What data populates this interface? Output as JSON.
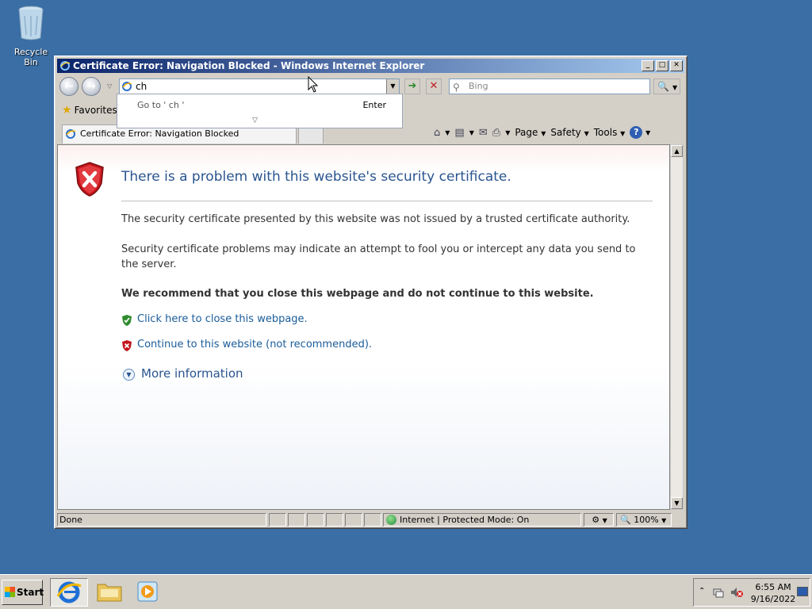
{
  "desktop": {
    "recycle_bin_label": "Recycle Bin"
  },
  "window": {
    "title": "Certificate Error: Navigation Blocked - Windows Internet Explorer",
    "minimize": "_",
    "maximize": "□",
    "close": "✕"
  },
  "navbar": {
    "back": "←",
    "forward": "→",
    "address_value": "ch",
    "search_placeholder": "Bing"
  },
  "autocomplete": {
    "goto_text": "Go to ' ch '",
    "enter_label": "Enter",
    "more_glyph": "▽"
  },
  "favorites": {
    "label": "Favorites"
  },
  "tab": {
    "title": "Certificate Error: Navigation Blocked"
  },
  "commandbar": {
    "page": "Page",
    "safety": "Safety",
    "tools": "Tools",
    "help": "?"
  },
  "content": {
    "heading": "There is a problem with this website's security certificate.",
    "p1": "The security certificate presented by this website was not issued by a trusted certificate authority.",
    "p2": "Security certificate problems may indicate an attempt to fool you or intercept any data you send to the server.",
    "recommend": "We recommend that you close this webpage and do not continue to this website.",
    "link_close": "Click here to close this webpage.",
    "link_continue": "Continue to this website (not recommended).",
    "more_info": "More information"
  },
  "statusbar": {
    "status": "Done",
    "zone": "Internet | Protected Mode: On",
    "zoom": "100%"
  },
  "taskbar": {
    "start_label": "Start",
    "time": "6:55 AM",
    "date": "9/16/2022"
  },
  "colors": {
    "desktop": "#3a6ea5",
    "heading": "#2a5590",
    "link": "#1a5c9a",
    "shield_red": "#c4161c",
    "shield_green": "#2e8b2e"
  }
}
